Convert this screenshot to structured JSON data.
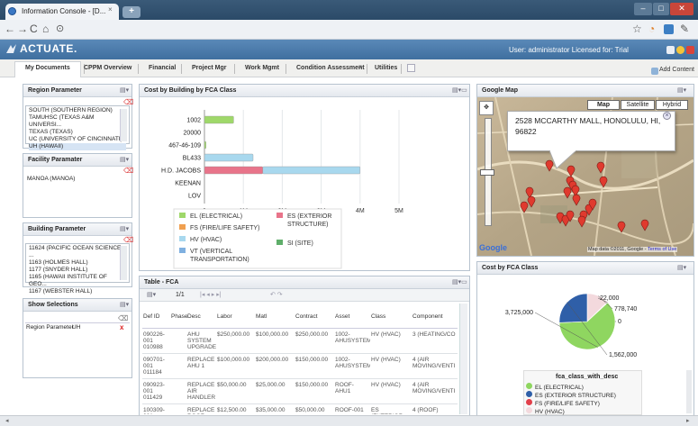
{
  "browser": {
    "tab_title": "Information Console - [D...",
    "new_tab": "+",
    "close": "×"
  },
  "header": {
    "logo": "ACTUATE.",
    "user_text": "User: administrator   Licensed for: Trial"
  },
  "tabs": [
    {
      "label": "My Documents"
    },
    {
      "label": "CPPM Overview"
    },
    {
      "label": "Financial"
    },
    {
      "label": "Project Mgr"
    },
    {
      "label": "Work Mgmt"
    },
    {
      "label": "Condition Assessment"
    },
    {
      "label": "Utilities"
    }
  ],
  "add_content": "Add Content",
  "region": {
    "title": "Region Parameter",
    "items": [
      "SOUTH (SOUTHERN REGION)",
      "TAMUHSC (TEXAS A&M UNIVERSI...",
      "TEXAS (TEXAS)",
      "UC (UNIVERSITY OF CINCINNATI)",
      "UH (HAWAII)"
    ]
  },
  "facility": {
    "title": "Facility Paramater",
    "items": [
      "MANOA (MANOA)"
    ]
  },
  "building": {
    "title": "Building Parameter",
    "items": [
      "11624 (PACIFIC OCEAN SCIENCE ...",
      "1163 (HOLMES HALL)",
      "1177 (SNYDER HALL)",
      "1165 (HAWAII INSTITUTE OF GEO...",
      "1167 (WEBSTER HALL)"
    ]
  },
  "selections": {
    "title": "Show Selections",
    "row_label": "Region Parameter",
    "row_value": "UH",
    "remove": "x"
  },
  "cost_chart_title": "Cost by Building by FCA Class",
  "map": {
    "title": "Google Map",
    "btn_map": "Map",
    "btn_satellite": "Satellite",
    "btn_hybrid": "Hybrid",
    "popup_line1": "2528 MCCARTHY MALL, HONOLULU, HI,",
    "popup_line2": "96822",
    "google": "Google",
    "attribution": "Map data ©2011, Google -",
    "terms": "Terms of Use"
  },
  "table_panel": {
    "title": "Table - FCA",
    "page": "1/1",
    "headers": [
      "Def ID",
      "Phase",
      "Desc",
      "Labor",
      "Matl",
      "Contract",
      "Asset",
      "Class",
      "Component"
    ],
    "rows": [
      {
        "def_id": "090226-001 010988",
        "phase": "",
        "desc": "AHU SYSTEM UPGRADE",
        "labor": "$250,000.00",
        "matl": "$100,000.00",
        "contract": "$250,000.00",
        "asset": "1002-AHUSYSTEM",
        "class": "HV (HVAC)",
        "component": "3 (HEATING/CO"
      },
      {
        "def_id": "090701-001 011184",
        "phase": "",
        "desc": "REPLACE AHU 1",
        "labor": "$100,000.00",
        "matl": "$200,000.00",
        "contract": "$150,000.00",
        "asset": "1002-AHUSYSTEM",
        "class": "HV (HVAC)",
        "component": "4 (AIR MOVING/VENTI"
      },
      {
        "def_id": "090923-001 011429",
        "phase": "",
        "desc": "REPLACE AIR HANDLER",
        "labor": "$50,000.00",
        "matl": "$25,000.00",
        "contract": "$150,000.00",
        "asset": "ROOF-AHU1",
        "class": "HV (HVAC)",
        "component": "4 (AIR MOVING/VENTI"
      },
      {
        "def_id": "100309-001 011772",
        "phase": "",
        "desc": "REPLACE ROOF",
        "labor": "$12,500.00",
        "matl": "$35,000.00",
        "contract": "$50,000.00",
        "asset": "ROOF-001",
        "class": "ES (EXTERIOR",
        "component": "4 (ROOF)"
      }
    ]
  },
  "pie_panel_title": "Cost by FCA Class",
  "chart_data": [
    {
      "type": "bar",
      "orientation": "horizontal",
      "stacked": true,
      "categories": [
        "1002",
        "20000",
        "467-46-109",
        "BL433",
        "H.D. JACOBS",
        "KEENAN",
        "LOV"
      ],
      "series": [
        {
          "name": "EL (ELECTRICAL)",
          "color": "#9fd86a",
          "values": [
            0.75,
            0,
            0.04,
            0,
            0,
            0,
            0
          ]
        },
        {
          "name": "ES (EXTERIOR STRUCTURE)",
          "color": "#e8748a",
          "values": [
            0,
            0,
            0,
            0,
            1.5,
            0,
            0
          ]
        },
        {
          "name": "FS (FIRE/LIFE SAFETY)",
          "color": "#f0a050",
          "values": [
            0,
            0,
            0,
            0,
            0,
            0,
            0
          ]
        },
        {
          "name": "SI (SITE)",
          "color": "#5fae6a",
          "values": [
            0,
            0,
            0,
            0,
            0,
            0,
            0
          ]
        },
        {
          "name": "HV (HVAC)",
          "color": "#a8d8ee",
          "values": [
            0,
            0,
            0,
            1.25,
            2.5,
            0,
            0
          ]
        },
        {
          "name": "VT (VERTICAL TRANSPORTATION)",
          "color": "#7fb0e0",
          "values": [
            0,
            0,
            0,
            0,
            0,
            0,
            0
          ]
        }
      ],
      "xticks": [
        "0",
        "1M",
        "2M",
        "3M",
        "4M",
        "5M"
      ],
      "xlim": [
        0,
        5
      ],
      "value_unit": "M"
    },
    {
      "type": "pie",
      "title": "fca_class_with_desc",
      "slices": [
        {
          "name": "EL (ELECTRICAL)",
          "value": 3725000,
          "color": "#8fd660"
        },
        {
          "name": "ES (EXTERIOR STRUCTURE)",
          "value": 1562000,
          "color": "#2f5fa8"
        },
        {
          "name": "FS (FIRE/LIFE SAFETY)",
          "value": 22000,
          "color": "#e23f4a"
        },
        {
          "name": "HV (HVAC)",
          "value": 778740,
          "color": "#f3d9dd"
        },
        {
          "name": "",
          "value": 0,
          "color": "#f0a050"
        }
      ],
      "labels": [
        "3,725,000",
        "1,562,000",
        "22,000",
        "778,740",
        "0"
      ],
      "legend": [
        "EL (ELECTRICAL)",
        "ES (EXTERIOR STRUCTURE)",
        "FS (FIRE/LIFE SAFETY)",
        "HV (HVAC)"
      ]
    }
  ]
}
